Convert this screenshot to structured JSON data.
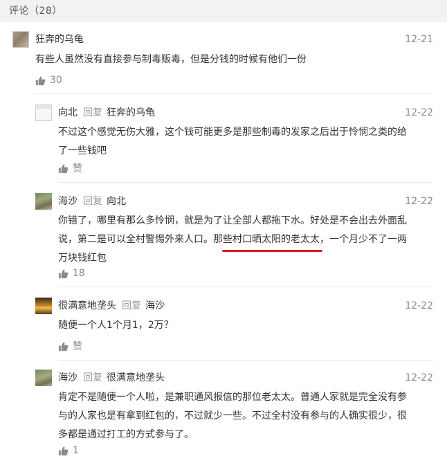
{
  "header": {
    "title": "评论（28）"
  },
  "comments": [
    {
      "author": "狂奔的乌龟",
      "date": "12-21",
      "text": "有些人虽然没有直接参与制毒贩毒，但是分钱的时候有他们一份",
      "likes": "30"
    },
    {
      "author": "向北",
      "reply_label": "回复",
      "reply_to": "狂奔的乌龟",
      "date": "12-22",
      "text_line1": "不过这个感觉无伤大雅，这个钱可能更多是那些制毒的发家之后出于怜悯之类的给",
      "text_line2": "了一些钱吧",
      "likes": "赞"
    },
    {
      "author": "海沙",
      "reply_label": "回复",
      "reply_to": "向北",
      "date": "12-22",
      "text_line1": "你错了，哪里有那么多怜悯，就是为了让全部人都拖下水。好处是不会出去外面乱",
      "text_line2": "说，第二是可以全村警惕外来人口。那些村口晒太阳的老太太，一个月少不了一两",
      "text_line3": "万块钱红包",
      "likes": "18",
      "highlight_color": "#e01b1b"
    },
    {
      "author": "很满意地垄头",
      "reply_label": "回复",
      "reply_to": "海沙",
      "date": "12-22",
      "text": "随便一个人1个月1，2万？",
      "likes": "赞"
    },
    {
      "author": "海沙",
      "reply_label": "回复",
      "reply_to": "很满意地垄头",
      "date": "12-22",
      "text_line1": "肯定不是随便一个人啦，是兼职通风报信的那位老太太。普通人家就是完全没有参",
      "text_line2": "与的人家也是有拿到红包的，不过就少一些。不过全村没有参与的人确实很少，很",
      "text_line3": "多都是通过打工的方式参与了。",
      "likes": "1"
    }
  ],
  "icons": {
    "like": "thumbs-up-icon"
  },
  "colors": {
    "accent_underline": "#e01b1b",
    "muted": "#8a8a8a"
  }
}
